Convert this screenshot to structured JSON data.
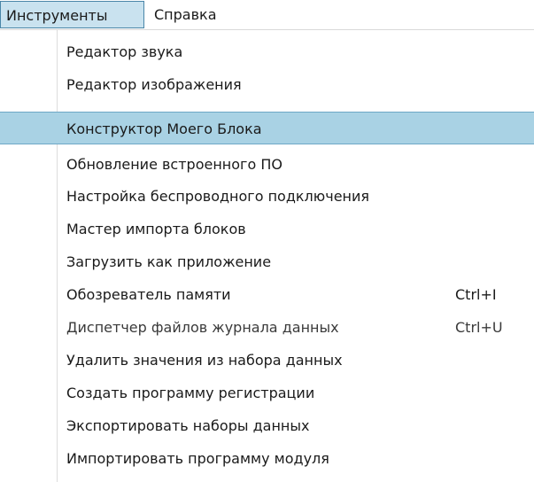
{
  "menubar": {
    "items": [
      {
        "label": "Инструменты",
        "active": true
      },
      {
        "label": "Справка",
        "active": false
      }
    ]
  },
  "dropdown": {
    "highlighted_index": 2,
    "items": [
      {
        "label": "Редактор звука",
        "shortcut": ""
      },
      {
        "label": "Редактор изображения",
        "shortcut": ""
      },
      {
        "label": "Конструктор Моего Блока",
        "shortcut": ""
      },
      {
        "label": "Обновление встроенного ПО",
        "shortcut": ""
      },
      {
        "label": "Настройка беспроводного подключения",
        "shortcut": ""
      },
      {
        "label": "Мастер импорта блоков",
        "shortcut": ""
      },
      {
        "label": "Загрузить как приложение",
        "shortcut": ""
      },
      {
        "label": "Обозреватель памяти",
        "shortcut": "Ctrl+I"
      },
      {
        "label": "Диспетчер файлов журнала данных",
        "shortcut": "Ctrl+U"
      },
      {
        "label": "Удалить значения из набора данных",
        "shortcut": ""
      },
      {
        "label": "Создать программу регистрации",
        "shortcut": ""
      },
      {
        "label": "Экспортировать наборы данных",
        "shortcut": ""
      },
      {
        "label": "Импортировать программу модуля",
        "shortcut": ""
      }
    ]
  },
  "colors": {
    "menubar_active_bg": "#c9e2ef",
    "menubar_active_border": "#4a86a8",
    "highlight_bg": "#a9d2e4",
    "highlight_border": "#6ea8c6",
    "text": "#1a1a1a"
  }
}
